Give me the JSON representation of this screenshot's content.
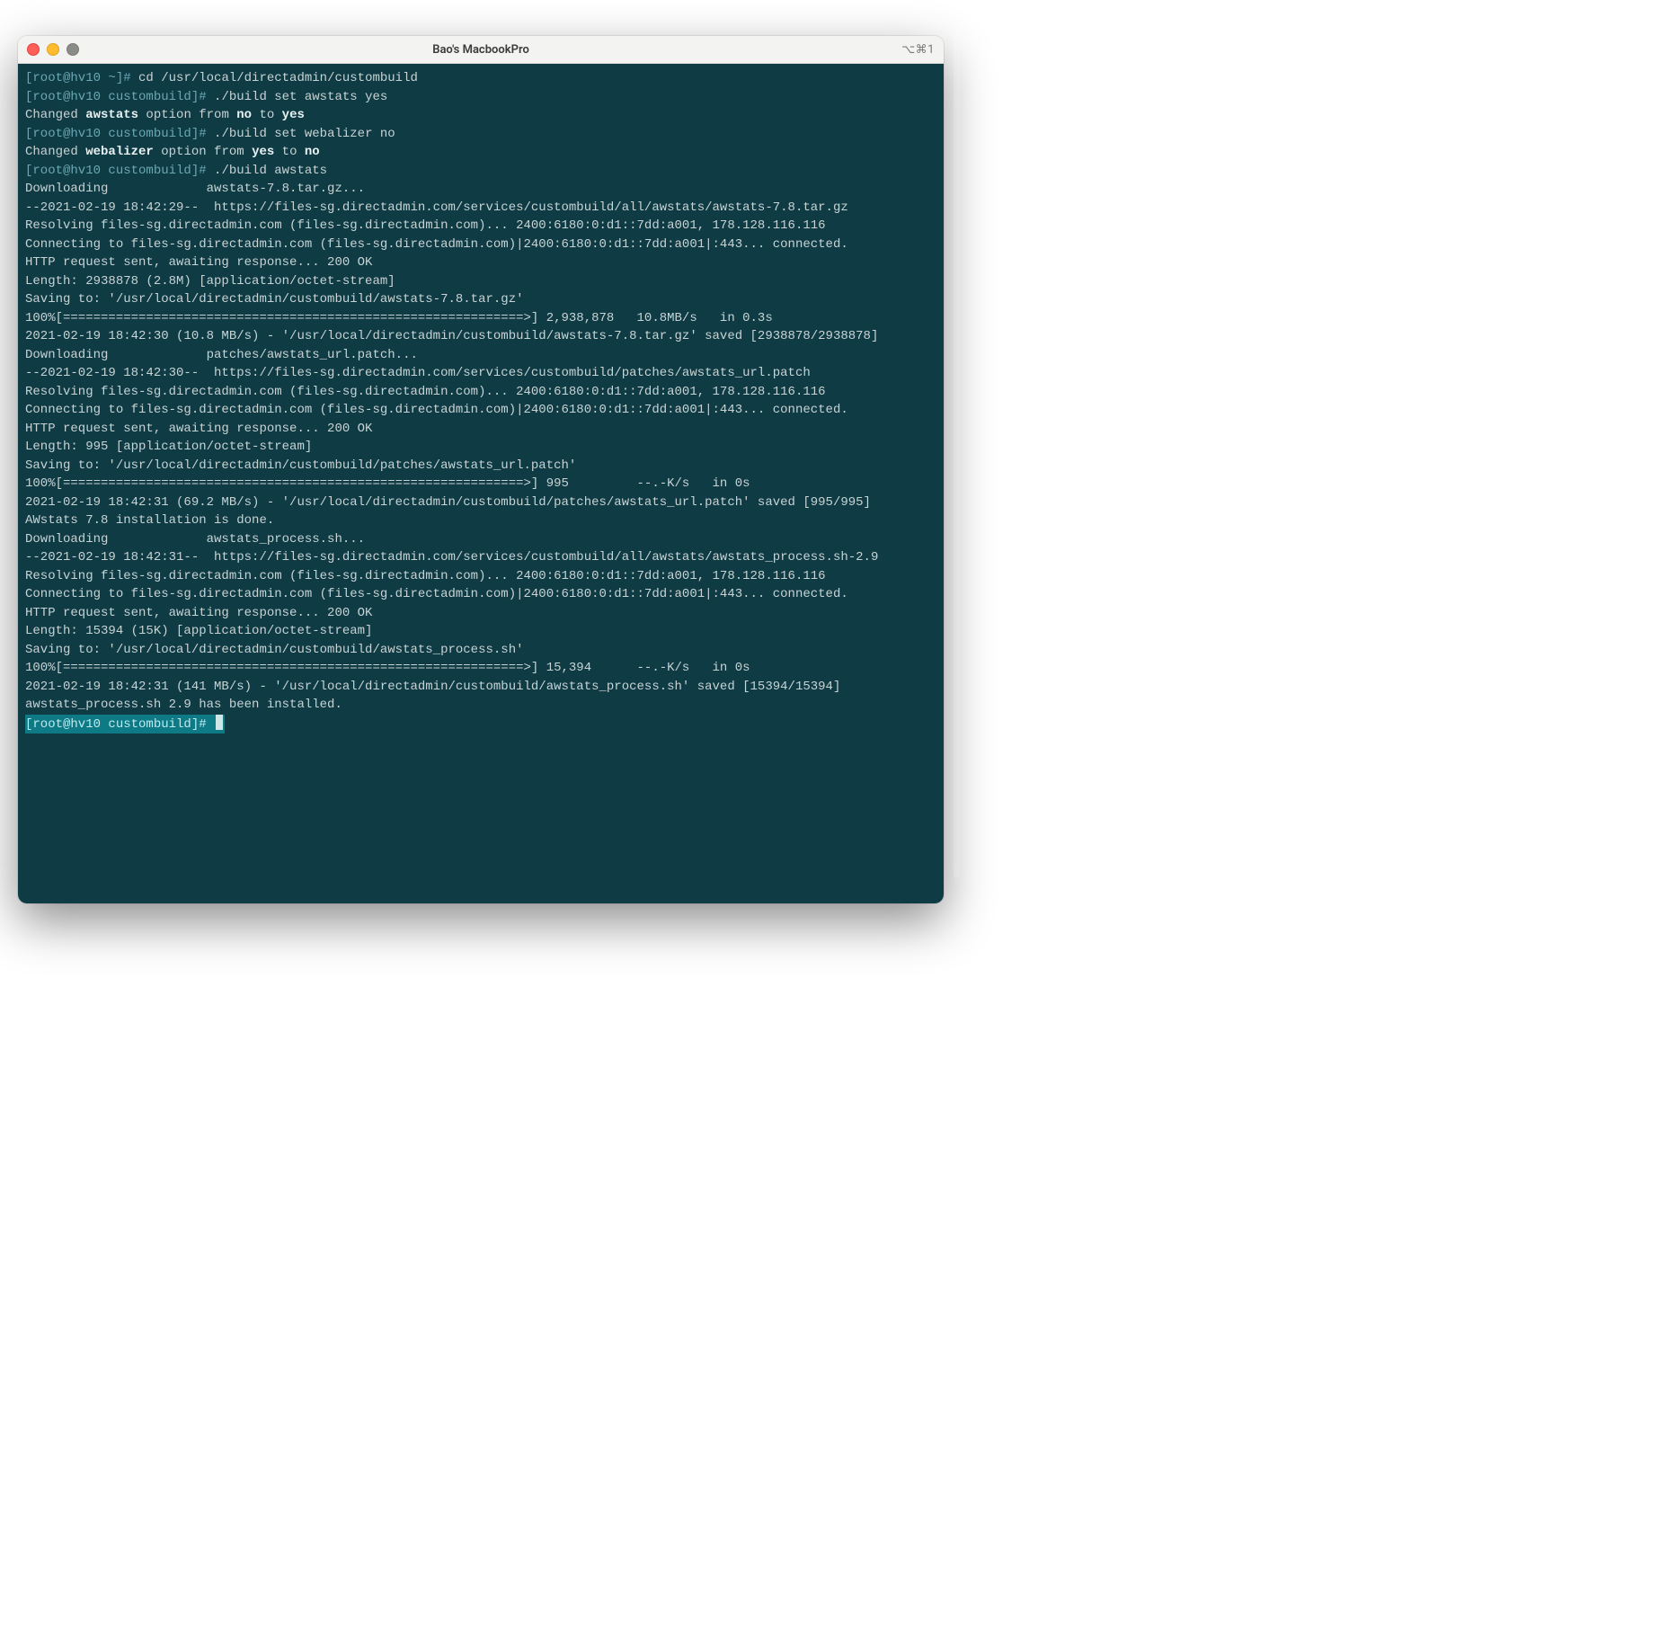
{
  "window": {
    "title": "Bao's MacbookPro",
    "shortcut": "⌥⌘1"
  },
  "colors": {
    "term_bg": "#0f3b45",
    "prompt": "#6aa8b3",
    "text": "#c8d3d4",
    "highlight_bg": "#0e7a86"
  },
  "terminal": {
    "lines": [
      {
        "t": "p",
        "prompt": "[root@hv10 ~]# ",
        "cmd": "cd /usr/local/directadmin/custombuild"
      },
      {
        "t": "p",
        "prompt": "[root@hv10 custombuild]# ",
        "cmd": "./build set awstats yes"
      },
      {
        "t": "chg",
        "p1": "Changed ",
        "b1": "awstats",
        "p2": " option from ",
        "b2": "no",
        "p3": " to ",
        "b3": "yes"
      },
      {
        "t": "p",
        "prompt": "[root@hv10 custombuild]# ",
        "cmd": "./build set webalizer no"
      },
      {
        "t": "chg",
        "p1": "Changed ",
        "b1": "webalizer",
        "p2": " option from ",
        "b3": "no",
        "b2": "yes",
        "p3": " to "
      },
      {
        "t": "p",
        "prompt": "[root@hv10 custombuild]# ",
        "cmd": "./build awstats"
      },
      {
        "t": "o",
        "text": "Downloading             awstats-7.8.tar.gz..."
      },
      {
        "t": "o",
        "text": "--2021-02-19 18:42:29--  https://files-sg.directadmin.com/services/custombuild/all/awstats/awstats-7.8.tar.gz"
      },
      {
        "t": "o",
        "text": "Resolving files-sg.directadmin.com (files-sg.directadmin.com)... 2400:6180:0:d1::7dd:a001, 178.128.116.116"
      },
      {
        "t": "o",
        "text": "Connecting to files-sg.directadmin.com (files-sg.directadmin.com)|2400:6180:0:d1::7dd:a001|:443... connected."
      },
      {
        "t": "o",
        "text": "HTTP request sent, awaiting response... 200 OK"
      },
      {
        "t": "o",
        "text": "Length: 2938878 (2.8M) [application/octet-stream]"
      },
      {
        "t": "o",
        "text": "Saving to: '/usr/local/directadmin/custombuild/awstats-7.8.tar.gz'"
      },
      {
        "t": "o",
        "text": ""
      },
      {
        "t": "o",
        "text": "100%[=============================================================>] 2,938,878   10.8MB/s   in 0.3s"
      },
      {
        "t": "o",
        "text": ""
      },
      {
        "t": "o",
        "text": "2021-02-19 18:42:30 (10.8 MB/s) - '/usr/local/directadmin/custombuild/awstats-7.8.tar.gz' saved [2938878/2938878]"
      },
      {
        "t": "o",
        "text": ""
      },
      {
        "t": "o",
        "text": "Downloading             patches/awstats_url.patch..."
      },
      {
        "t": "o",
        "text": "--2021-02-19 18:42:30--  https://files-sg.directadmin.com/services/custombuild/patches/awstats_url.patch"
      },
      {
        "t": "o",
        "text": "Resolving files-sg.directadmin.com (files-sg.directadmin.com)... 2400:6180:0:d1::7dd:a001, 178.128.116.116"
      },
      {
        "t": "o",
        "text": "Connecting to files-sg.directadmin.com (files-sg.directadmin.com)|2400:6180:0:d1::7dd:a001|:443... connected."
      },
      {
        "t": "o",
        "text": "HTTP request sent, awaiting response... 200 OK"
      },
      {
        "t": "o",
        "text": "Length: 995 [application/octet-stream]"
      },
      {
        "t": "o",
        "text": "Saving to: '/usr/local/directadmin/custombuild/patches/awstats_url.patch'"
      },
      {
        "t": "o",
        "text": ""
      },
      {
        "t": "o",
        "text": "100%[=============================================================>] 995         --.-K/s   in 0s"
      },
      {
        "t": "o",
        "text": ""
      },
      {
        "t": "o",
        "text": "2021-02-19 18:42:31 (69.2 MB/s) - '/usr/local/directadmin/custombuild/patches/awstats_url.patch' saved [995/995]"
      },
      {
        "t": "o",
        "text": ""
      },
      {
        "t": "o",
        "text": "AWstats 7.8 installation is done."
      },
      {
        "t": "o",
        "text": "Downloading             awstats_process.sh..."
      },
      {
        "t": "o",
        "text": "--2021-02-19 18:42:31--  https://files-sg.directadmin.com/services/custombuild/all/awstats/awstats_process.sh-2.9"
      },
      {
        "t": "o",
        "text": "Resolving files-sg.directadmin.com (files-sg.directadmin.com)... 2400:6180:0:d1::7dd:a001, 178.128.116.116"
      },
      {
        "t": "o",
        "text": "Connecting to files-sg.directadmin.com (files-sg.directadmin.com)|2400:6180:0:d1::7dd:a001|:443... connected."
      },
      {
        "t": "o",
        "text": "HTTP request sent, awaiting response... 200 OK"
      },
      {
        "t": "o",
        "text": "Length: 15394 (15K) [application/octet-stream]"
      },
      {
        "t": "o",
        "text": "Saving to: '/usr/local/directadmin/custombuild/awstats_process.sh'"
      },
      {
        "t": "o",
        "text": ""
      },
      {
        "t": "o",
        "text": "100%[=============================================================>] 15,394      --.-K/s   in 0s"
      },
      {
        "t": "o",
        "text": ""
      },
      {
        "t": "o",
        "text": "2021-02-19 18:42:31 (141 MB/s) - '/usr/local/directadmin/custombuild/awstats_process.sh' saved [15394/15394]"
      },
      {
        "t": "o",
        "text": ""
      },
      {
        "t": "o",
        "text": "awstats_process.sh 2.9 has been installed."
      }
    ],
    "active_prompt": "[root@hv10 custombuild]# "
  }
}
